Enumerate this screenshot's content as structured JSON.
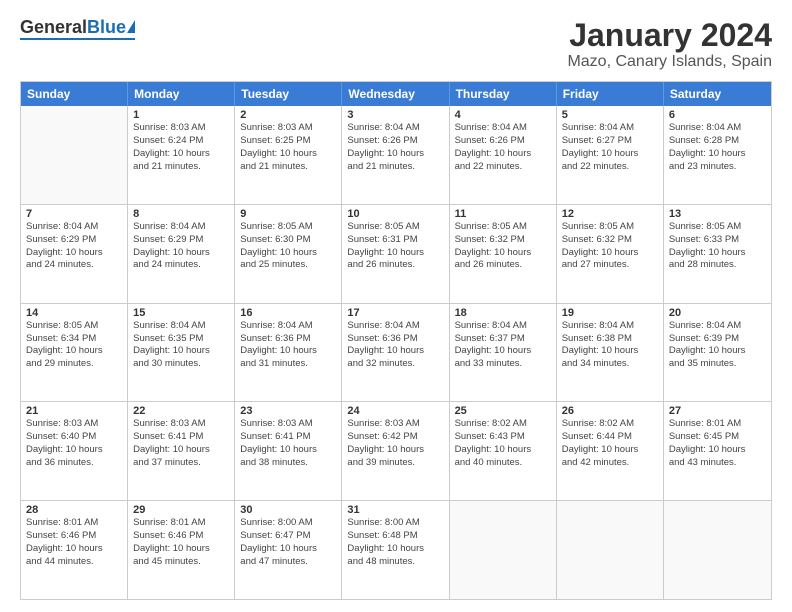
{
  "header": {
    "logo_general": "General",
    "logo_blue": "Blue",
    "title": "January 2024",
    "subtitle": "Mazo, Canary Islands, Spain"
  },
  "calendar": {
    "days_of_week": [
      "Sunday",
      "Monday",
      "Tuesday",
      "Wednesday",
      "Thursday",
      "Friday",
      "Saturday"
    ],
    "weeks": [
      [
        {
          "day": "",
          "info": ""
        },
        {
          "day": "1",
          "info": "Sunrise: 8:03 AM\nSunset: 6:24 PM\nDaylight: 10 hours\nand 21 minutes."
        },
        {
          "day": "2",
          "info": "Sunrise: 8:03 AM\nSunset: 6:25 PM\nDaylight: 10 hours\nand 21 minutes."
        },
        {
          "day": "3",
          "info": "Sunrise: 8:04 AM\nSunset: 6:26 PM\nDaylight: 10 hours\nand 21 minutes."
        },
        {
          "day": "4",
          "info": "Sunrise: 8:04 AM\nSunset: 6:26 PM\nDaylight: 10 hours\nand 22 minutes."
        },
        {
          "day": "5",
          "info": "Sunrise: 8:04 AM\nSunset: 6:27 PM\nDaylight: 10 hours\nand 22 minutes."
        },
        {
          "day": "6",
          "info": "Sunrise: 8:04 AM\nSunset: 6:28 PM\nDaylight: 10 hours\nand 23 minutes."
        }
      ],
      [
        {
          "day": "7",
          "info": "Sunrise: 8:04 AM\nSunset: 6:29 PM\nDaylight: 10 hours\nand 24 minutes."
        },
        {
          "day": "8",
          "info": "Sunrise: 8:04 AM\nSunset: 6:29 PM\nDaylight: 10 hours\nand 24 minutes."
        },
        {
          "day": "9",
          "info": "Sunrise: 8:05 AM\nSunset: 6:30 PM\nDaylight: 10 hours\nand 25 minutes."
        },
        {
          "day": "10",
          "info": "Sunrise: 8:05 AM\nSunset: 6:31 PM\nDaylight: 10 hours\nand 26 minutes."
        },
        {
          "day": "11",
          "info": "Sunrise: 8:05 AM\nSunset: 6:32 PM\nDaylight: 10 hours\nand 26 minutes."
        },
        {
          "day": "12",
          "info": "Sunrise: 8:05 AM\nSunset: 6:32 PM\nDaylight: 10 hours\nand 27 minutes."
        },
        {
          "day": "13",
          "info": "Sunrise: 8:05 AM\nSunset: 6:33 PM\nDaylight: 10 hours\nand 28 minutes."
        }
      ],
      [
        {
          "day": "14",
          "info": "Sunrise: 8:05 AM\nSunset: 6:34 PM\nDaylight: 10 hours\nand 29 minutes."
        },
        {
          "day": "15",
          "info": "Sunrise: 8:04 AM\nSunset: 6:35 PM\nDaylight: 10 hours\nand 30 minutes."
        },
        {
          "day": "16",
          "info": "Sunrise: 8:04 AM\nSunset: 6:36 PM\nDaylight: 10 hours\nand 31 minutes."
        },
        {
          "day": "17",
          "info": "Sunrise: 8:04 AM\nSunset: 6:36 PM\nDaylight: 10 hours\nand 32 minutes."
        },
        {
          "day": "18",
          "info": "Sunrise: 8:04 AM\nSunset: 6:37 PM\nDaylight: 10 hours\nand 33 minutes."
        },
        {
          "day": "19",
          "info": "Sunrise: 8:04 AM\nSunset: 6:38 PM\nDaylight: 10 hours\nand 34 minutes."
        },
        {
          "day": "20",
          "info": "Sunrise: 8:04 AM\nSunset: 6:39 PM\nDaylight: 10 hours\nand 35 minutes."
        }
      ],
      [
        {
          "day": "21",
          "info": "Sunrise: 8:03 AM\nSunset: 6:40 PM\nDaylight: 10 hours\nand 36 minutes."
        },
        {
          "day": "22",
          "info": "Sunrise: 8:03 AM\nSunset: 6:41 PM\nDaylight: 10 hours\nand 37 minutes."
        },
        {
          "day": "23",
          "info": "Sunrise: 8:03 AM\nSunset: 6:41 PM\nDaylight: 10 hours\nand 38 minutes."
        },
        {
          "day": "24",
          "info": "Sunrise: 8:03 AM\nSunset: 6:42 PM\nDaylight: 10 hours\nand 39 minutes."
        },
        {
          "day": "25",
          "info": "Sunrise: 8:02 AM\nSunset: 6:43 PM\nDaylight: 10 hours\nand 40 minutes."
        },
        {
          "day": "26",
          "info": "Sunrise: 8:02 AM\nSunset: 6:44 PM\nDaylight: 10 hours\nand 42 minutes."
        },
        {
          "day": "27",
          "info": "Sunrise: 8:01 AM\nSunset: 6:45 PM\nDaylight: 10 hours\nand 43 minutes."
        }
      ],
      [
        {
          "day": "28",
          "info": "Sunrise: 8:01 AM\nSunset: 6:46 PM\nDaylight: 10 hours\nand 44 minutes."
        },
        {
          "day": "29",
          "info": "Sunrise: 8:01 AM\nSunset: 6:46 PM\nDaylight: 10 hours\nand 45 minutes."
        },
        {
          "day": "30",
          "info": "Sunrise: 8:00 AM\nSunset: 6:47 PM\nDaylight: 10 hours\nand 47 minutes."
        },
        {
          "day": "31",
          "info": "Sunrise: 8:00 AM\nSunset: 6:48 PM\nDaylight: 10 hours\nand 48 minutes."
        },
        {
          "day": "",
          "info": ""
        },
        {
          "day": "",
          "info": ""
        },
        {
          "day": "",
          "info": ""
        }
      ]
    ]
  }
}
